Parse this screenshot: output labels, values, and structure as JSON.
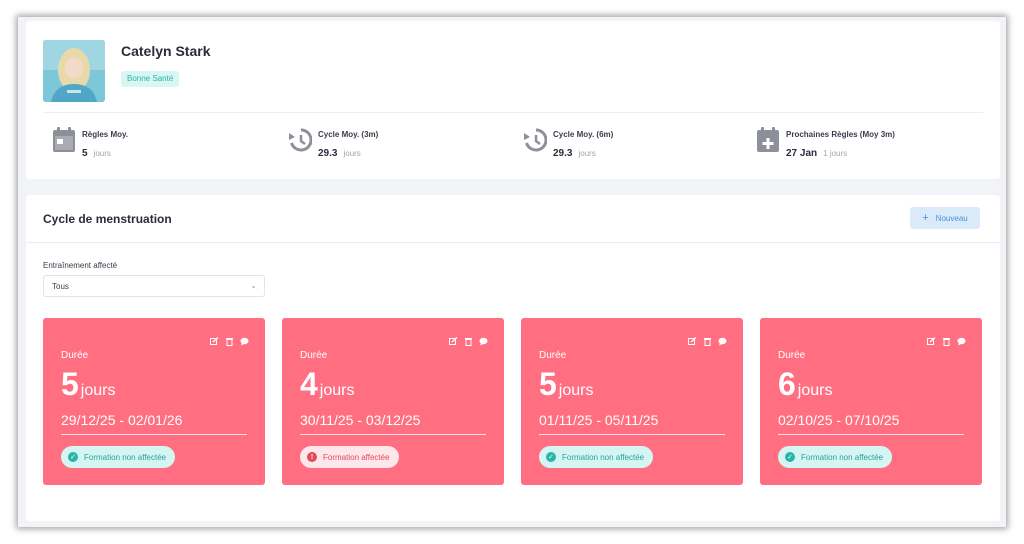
{
  "profile": {
    "name": "Catelyn Stark",
    "status_badge": "Bonne Santé"
  },
  "stats": [
    {
      "label": "Règles Moy.",
      "value": "5",
      "unit": "jours",
      "icon": "calendar-icon"
    },
    {
      "label": "Cycle Moy. (3m)",
      "value": "29.3",
      "unit": "jours",
      "icon": "history-icon"
    },
    {
      "label": "Cycle Moy. (6m)",
      "value": "29.3",
      "unit": "jours",
      "icon": "history-icon"
    },
    {
      "label": "Prochaines Règles (Moy 3m)",
      "value": "27 Jan",
      "unit": "1 jours",
      "icon": "calendar-plus-icon"
    }
  ],
  "cycle_section": {
    "title": "Cycle de menstruation",
    "new_button_label": "Nouveau",
    "filter_label": "Entraînement affecté",
    "filter_value": "Tous"
  },
  "periods": [
    {
      "duration_label": "Durée",
      "days": "5",
      "unit": "jours",
      "dates": "29/12/25 - 02/01/26",
      "tag": "Formation non affectée",
      "tag_status": "ok"
    },
    {
      "duration_label": "Durée",
      "days": "4",
      "unit": "jours",
      "dates": "30/11/25 - 03/12/25",
      "tag": "Formation affectée",
      "tag_status": "bad"
    },
    {
      "duration_label": "Durée",
      "days": "5",
      "unit": "jours",
      "dates": "01/11/25 - 05/11/25",
      "tag": "Formation non affectée",
      "tag_status": "ok"
    },
    {
      "duration_label": "Durée",
      "days": "6",
      "unit": "jours",
      "dates": "02/10/25 - 07/10/25",
      "tag": "Formation non affectée",
      "tag_status": "ok"
    }
  ],
  "colors": {
    "card_accent": "#ff6f81",
    "ok_tag": "#29b4ab",
    "bad_tag": "#e24a58",
    "primary_button": "#4a90d9"
  }
}
